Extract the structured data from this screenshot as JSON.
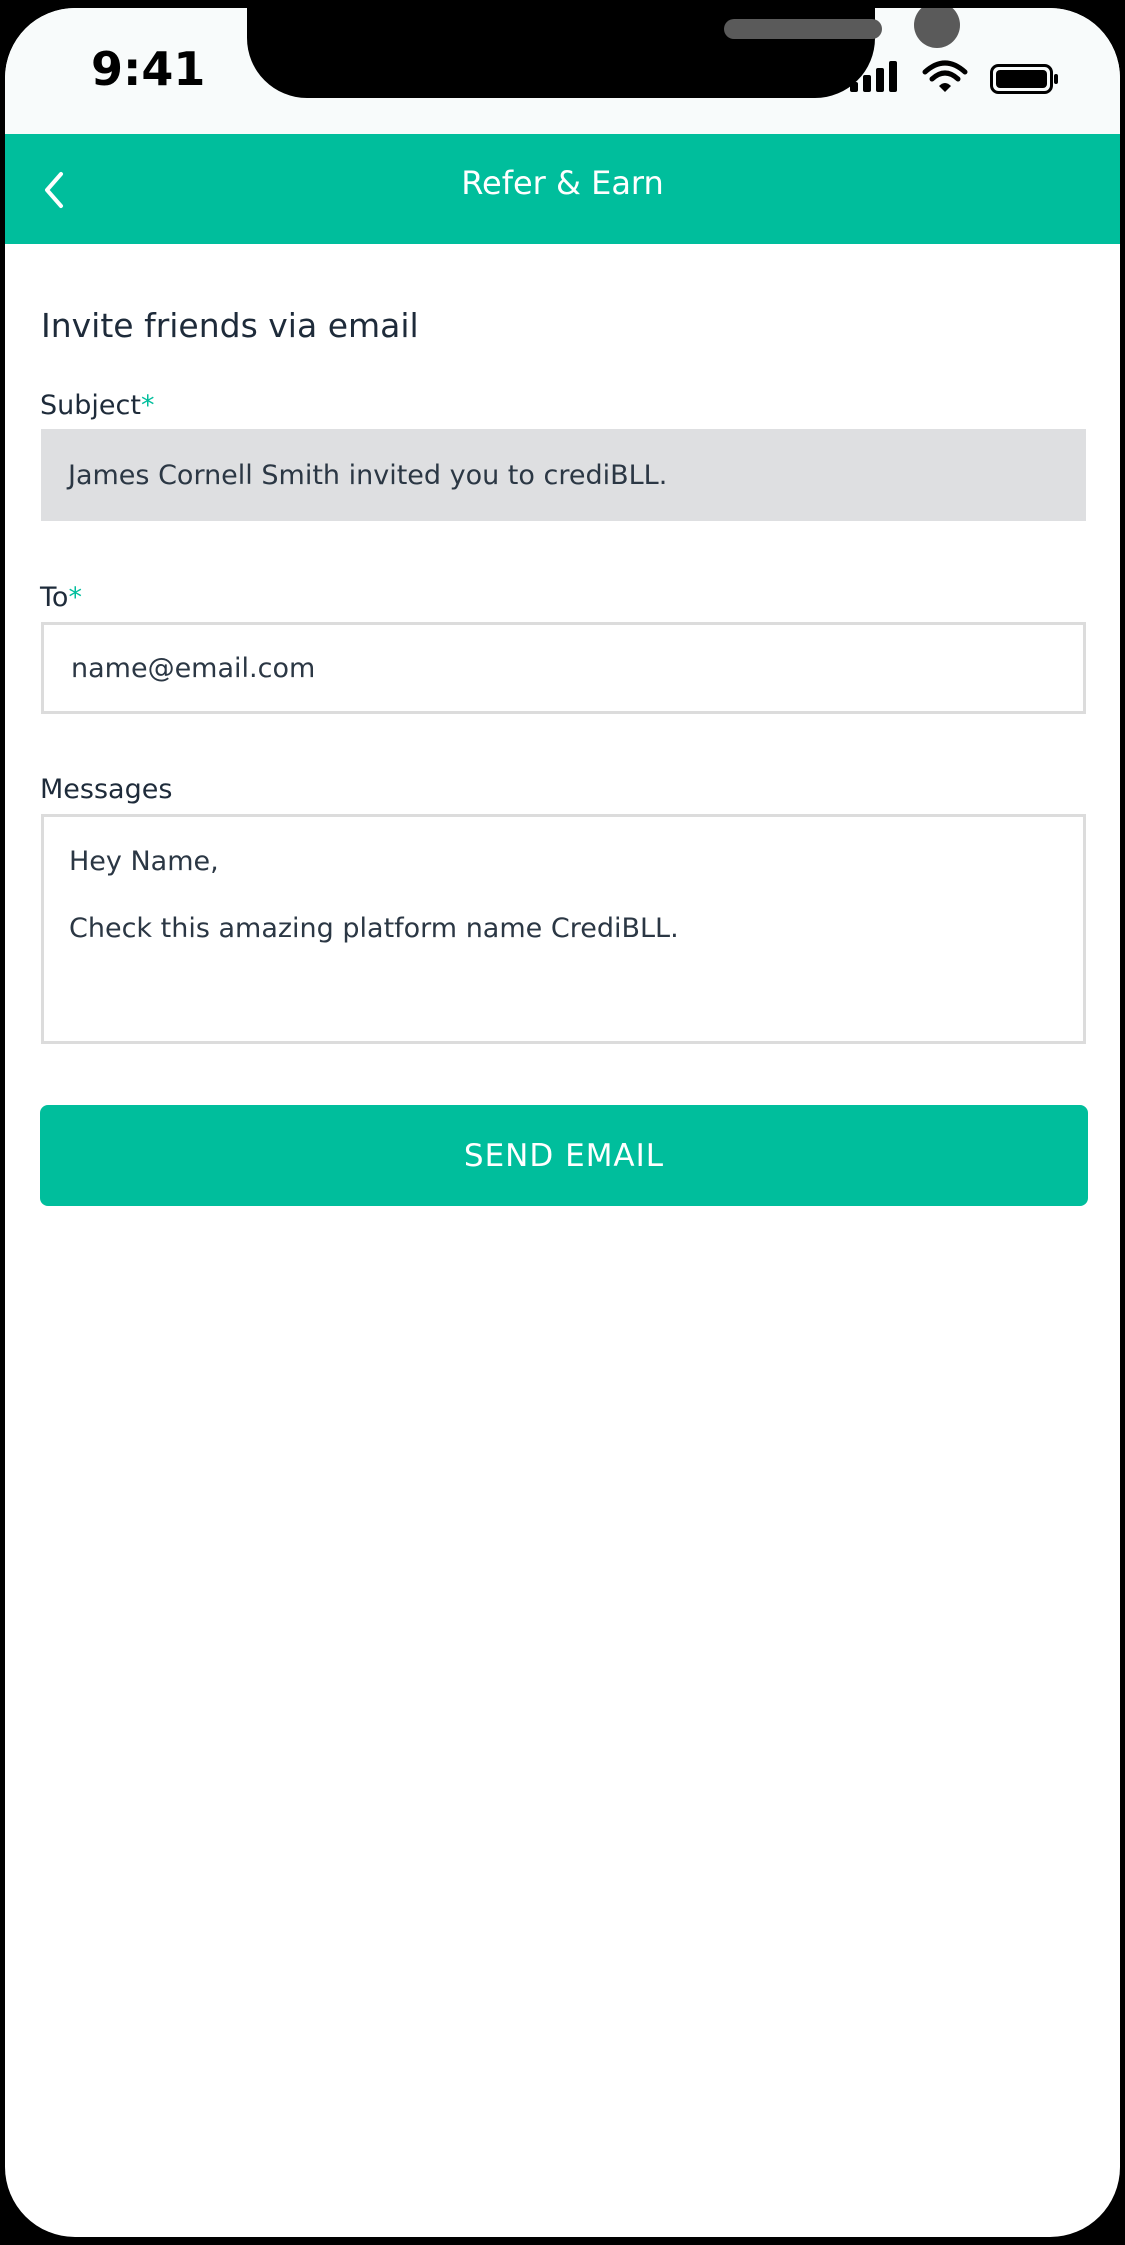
{
  "status_bar": {
    "time": "9:41",
    "icons": [
      "signal-icon",
      "wifi-icon",
      "battery-icon"
    ]
  },
  "header": {
    "title": "Refer & Earn",
    "back_icon": "chevron-left-icon",
    "background": "#00be9c"
  },
  "form": {
    "section_title": "Invite friends via email",
    "subject": {
      "label": "Subject",
      "required_mark": "*",
      "value": "James Cornell Smith invited you to crediBLL."
    },
    "to": {
      "label": "To",
      "required_mark": "*",
      "placeholder": "name@email.com"
    },
    "messages": {
      "label": "Messages",
      "line1": "Hey Name,",
      "line2": "Check this amazing platform name CrediBLL."
    },
    "send_button_label": "SEND EMAIL"
  },
  "colors": {
    "accent": "#00be9c",
    "text": "#1e2b3a",
    "readonly_field": "#dedfe1"
  }
}
